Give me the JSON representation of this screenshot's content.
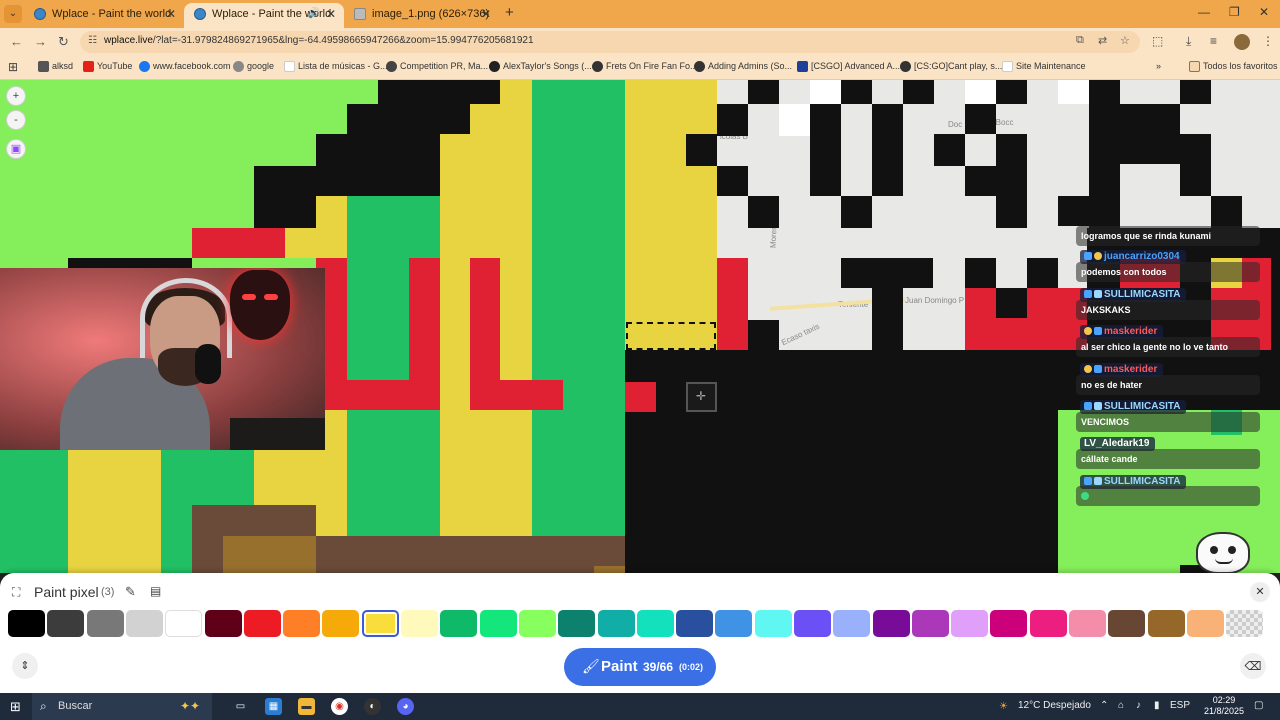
{
  "browser": {
    "tabs": [
      {
        "title": "Wplace - Paint the world",
        "active": false
      },
      {
        "title": "Wplace - Paint the world",
        "active": true
      },
      {
        "title": "image_1.png (626×736)",
        "active": false
      }
    ],
    "address": {
      "domain": "wplace.live",
      "path": "/?lat=-31.979824869271965&lng=-64.49598665947266&zoom=15.994776205681921"
    },
    "bookmarks": [
      {
        "label": "alksd",
        "color": "#555555"
      },
      {
        "label": "YouTube",
        "color": "#e62117"
      },
      {
        "label": "www.facebook.com",
        "color": "#1877f2"
      },
      {
        "label": "google",
        "color": "#888888"
      },
      {
        "label": "Lista de músicas - G...",
        "color": "#ffffff"
      },
      {
        "label": "Competition PR, Ma...",
        "color": "#444444"
      },
      {
        "label": "AlexTaylor's Songs (...",
        "color": "#222222"
      },
      {
        "label": "Frets On Fire Fan Fo...",
        "color": "#333333"
      },
      {
        "label": "Adding Admins (So...",
        "color": "#333333"
      },
      {
        "label": "[CSGO] Advanced A...",
        "color": "#1e3f9a"
      },
      {
        "label": "[CS:GO]Cant play, s...",
        "color": "#333333"
      },
      {
        "label": "Site Maintenance",
        "color": "#ffffff"
      }
    ],
    "all_bookmarks": "Todos los favoritos"
  },
  "map": {
    "streets": [
      "icolás B",
      "Doc",
      "ás Bocc",
      "Moreno",
      "Teniente",
      "Juan Domingo P",
      "Ecaso taxis"
    ],
    "zoom_in": "+",
    "zoom_out": "-"
  },
  "chat": {
    "entries": [
      {
        "type": "msg",
        "text": "logramos que se rinda kunami"
      },
      {
        "type": "user",
        "text": "juancarrizo0304",
        "color": "#4aa3ff"
      },
      {
        "type": "msg",
        "text": "podemos con todos"
      },
      {
        "type": "user",
        "text": "SULLIMICASITA",
        "color": "#9ad8ff"
      },
      {
        "type": "msg",
        "text": "JAKSKAKS"
      },
      {
        "type": "user",
        "text": "maskerider",
        "color": "#ff5a5a"
      },
      {
        "type": "msg",
        "text": "al ser chico la gente no lo ve tanto"
      },
      {
        "type": "user",
        "text": "maskerider",
        "color": "#ff5a5a"
      },
      {
        "type": "msg",
        "text": "no es de hater"
      },
      {
        "type": "user",
        "text": "SULLIMICASITA",
        "color": "#9ad8ff"
      },
      {
        "type": "msg",
        "text": "VENCIMOS"
      },
      {
        "type": "user",
        "text": "LV_Aledark19",
        "color": "#ffffff"
      },
      {
        "type": "msg",
        "text": "cállate cande"
      },
      {
        "type": "user",
        "text": "SULLIMICASITA",
        "color": "#9ad8ff"
      },
      {
        "type": "msg",
        "text": ""
      }
    ]
  },
  "paint_panel": {
    "title": "Paint pixel",
    "count": "(3)",
    "colors": [
      {
        "name": "black",
        "hex": "#000000"
      },
      {
        "name": "dark-gray",
        "hex": "#3c3c3c"
      },
      {
        "name": "gray",
        "hex": "#787878"
      },
      {
        "name": "light-gray",
        "hex": "#d2d2d2"
      },
      {
        "name": "white",
        "hex": "#ffffff"
      },
      {
        "name": "deep-red",
        "hex": "#600018"
      },
      {
        "name": "red",
        "hex": "#ed1c24"
      },
      {
        "name": "orange",
        "hex": "#ff7f27"
      },
      {
        "name": "gold",
        "hex": "#f6aa09"
      },
      {
        "name": "yellow",
        "hex": "#f9dd3b",
        "selected": true
      },
      {
        "name": "light-yellow",
        "hex": "#fffabc"
      },
      {
        "name": "dark-green",
        "hex": "#0eb968"
      },
      {
        "name": "green",
        "hex": "#13e67b"
      },
      {
        "name": "light-green",
        "hex": "#87ff5e"
      },
      {
        "name": "dark-teal",
        "hex": "#0c816e"
      },
      {
        "name": "teal",
        "hex": "#10aea6"
      },
      {
        "name": "light-teal",
        "hex": "#13e1be"
      },
      {
        "name": "dark-blue",
        "hex": "#28509e"
      },
      {
        "name": "blue",
        "hex": "#4093e4"
      },
      {
        "name": "cyan",
        "hex": "#60f7f2"
      },
      {
        "name": "indigo",
        "hex": "#6b50f6"
      },
      {
        "name": "light-indigo",
        "hex": "#99b1fb"
      },
      {
        "name": "dark-purple",
        "hex": "#780c99"
      },
      {
        "name": "purple",
        "hex": "#aa38b9"
      },
      {
        "name": "light-purple",
        "hex": "#e09ff9"
      },
      {
        "name": "dark-pink",
        "hex": "#cb007a"
      },
      {
        "name": "pink",
        "hex": "#ec1f80"
      },
      {
        "name": "light-pink",
        "hex": "#f38da9"
      },
      {
        "name": "dark-brown",
        "hex": "#684634"
      },
      {
        "name": "brown",
        "hex": "#95682a"
      },
      {
        "name": "beige",
        "hex": "#f8b277"
      },
      {
        "name": "transparent",
        "hex": "transparent"
      }
    ],
    "paint_button": {
      "label": "Paint",
      "charges": "39/66",
      "timer": "(0:02)"
    }
  },
  "taskbar": {
    "search_placeholder": "Buscar",
    "weather": "12°C  Despejado",
    "lang": "ESP",
    "time": "02:29",
    "date": "21/8/2025"
  },
  "colors": {
    "tab_bar": "#f0a64a",
    "toolbar": "#fbe4c5",
    "paint_button": "#3a6fe6",
    "taskbar": "#1f2a3a"
  }
}
